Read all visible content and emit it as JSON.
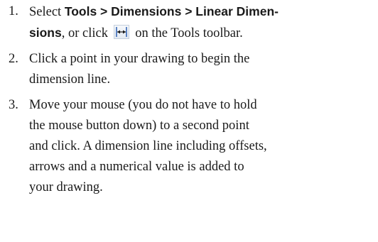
{
  "steps": [
    {
      "number": "1.",
      "parts": {
        "a": "Select ",
        "b": "Tools > Dimensions > Linear Dimen-",
        "c": "sions",
        "d": ", or click ",
        "e": " on the Tools toolbar."
      },
      "icon": "linear-dimension-icon"
    },
    {
      "number": "2.",
      "line1": "Click a point in your drawing to begin the",
      "line2": "dimension line."
    },
    {
      "number": "3.",
      "line1": "Move your mouse (you do not have to hold",
      "line2": "the mouse button down) to a second point",
      "line3": "and click. A dimension line including offsets,",
      "line4": "arrows and a numerical value is added to",
      "line5": "your drawing."
    }
  ],
  "colors": {
    "text": "#1a1a1a",
    "icon_stroke": "#2b5fb3"
  }
}
